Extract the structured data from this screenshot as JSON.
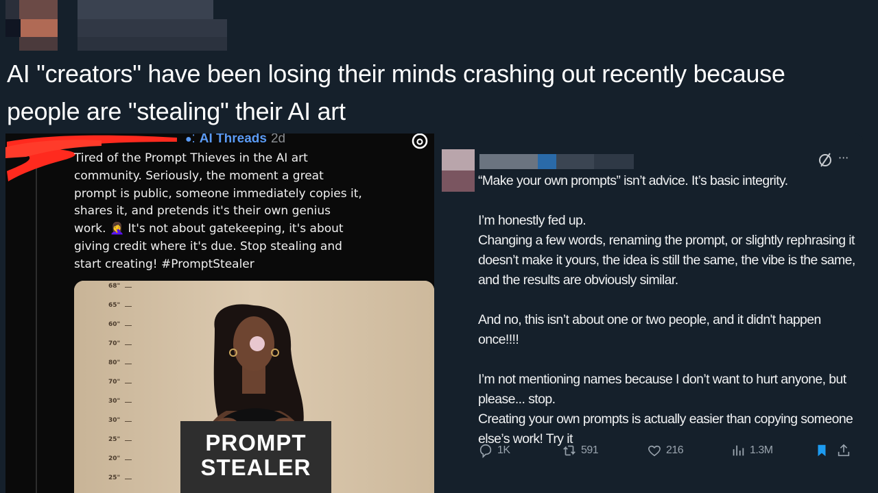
{
  "tweet": {
    "text_line1": "AI \"creators\" have been losing their minds crashing out recently because",
    "text_line2": "people are \"stealing\" their AI art"
  },
  "threads_post": {
    "author": "AI Threads",
    "age": "2d",
    "body": "Tired of the Prompt Thieves in the AI art\ncommunity. Seriously, the moment a great\nprompt is public, someone immediately copies it,\nshares it, and pretends it's their own genius\nwork. 🤦‍♀️ It's not about gatekeeping, it's about\ngiving credit where it's due. Stop stealing and\nstart creating! #PromptStealer",
    "image": {
      "sign_line1": "PROMPT",
      "sign_line2": "STEALER",
      "height_labels": [
        "68\"",
        "65\"",
        "60\"",
        "70\"",
        "80\"",
        "70\"",
        "30\"",
        "30\"",
        "25\"",
        "20\"",
        "25\""
      ]
    }
  },
  "x_post": {
    "paragraphs": [
      "“Make your own prompts” isn’t advice. It’s basic integrity.",
      "",
      "I’m honestly fed up.",
      "Changing a few words, renaming the prompt, or slightly rephrasing it doesn’t make it yours, the idea is still the same, the vibe is the same, and the results are obviously similar.",
      "",
      "And no, this isn’t about one or two people, and it didn't happen once!!!!",
      "",
      "I’m not mentioning names because I don’t want to hurt anyone, but please... stop.",
      "Creating your own prompts is actually easier than copying someone else’s work! Try it"
    ],
    "actions": {
      "replies": "1K",
      "reposts": "591",
      "likes": "216",
      "views": "1.3M"
    },
    "more_label": "···"
  },
  "colors": {
    "background": "#15202b",
    "threads_blue": "#5b9bf5",
    "bookmark_blue": "#1d9bf0",
    "redaction_red": "#ff2a1e"
  }
}
